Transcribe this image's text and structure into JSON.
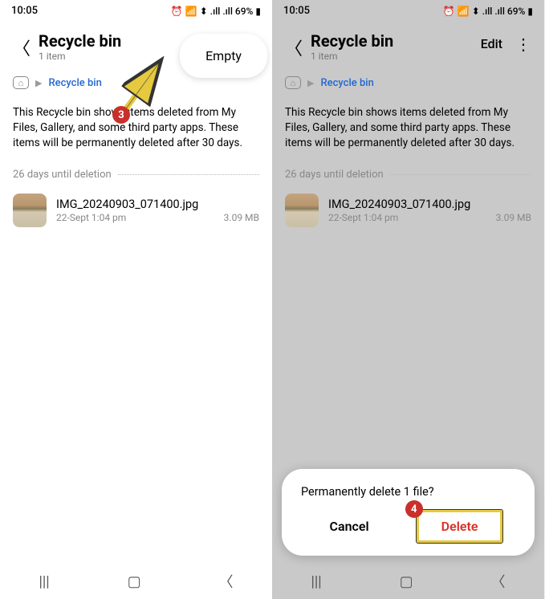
{
  "status": {
    "time": "10:05",
    "battery": "69%"
  },
  "header": {
    "title": "Recycle bin",
    "subtitle": "1 item",
    "edit_label": "Edit"
  },
  "empty_menu": {
    "label": "Empty"
  },
  "breadcrumb": {
    "current": "Recycle bin"
  },
  "description": "This Recycle bin shows items deleted from My Files, Gallery, and some third party apps. These items will be permanently deleted after 30 days.",
  "deletion_label": "26 days until deletion",
  "file": {
    "name": "IMG_20240903_071400.jpg",
    "date": "22-Sept 1:04 pm",
    "size": "3.09 MB"
  },
  "dialog": {
    "message": "Permanently delete 1 file?",
    "cancel": "Cancel",
    "delete": "Delete"
  },
  "annotations": {
    "step3": "3",
    "step4": "4"
  }
}
